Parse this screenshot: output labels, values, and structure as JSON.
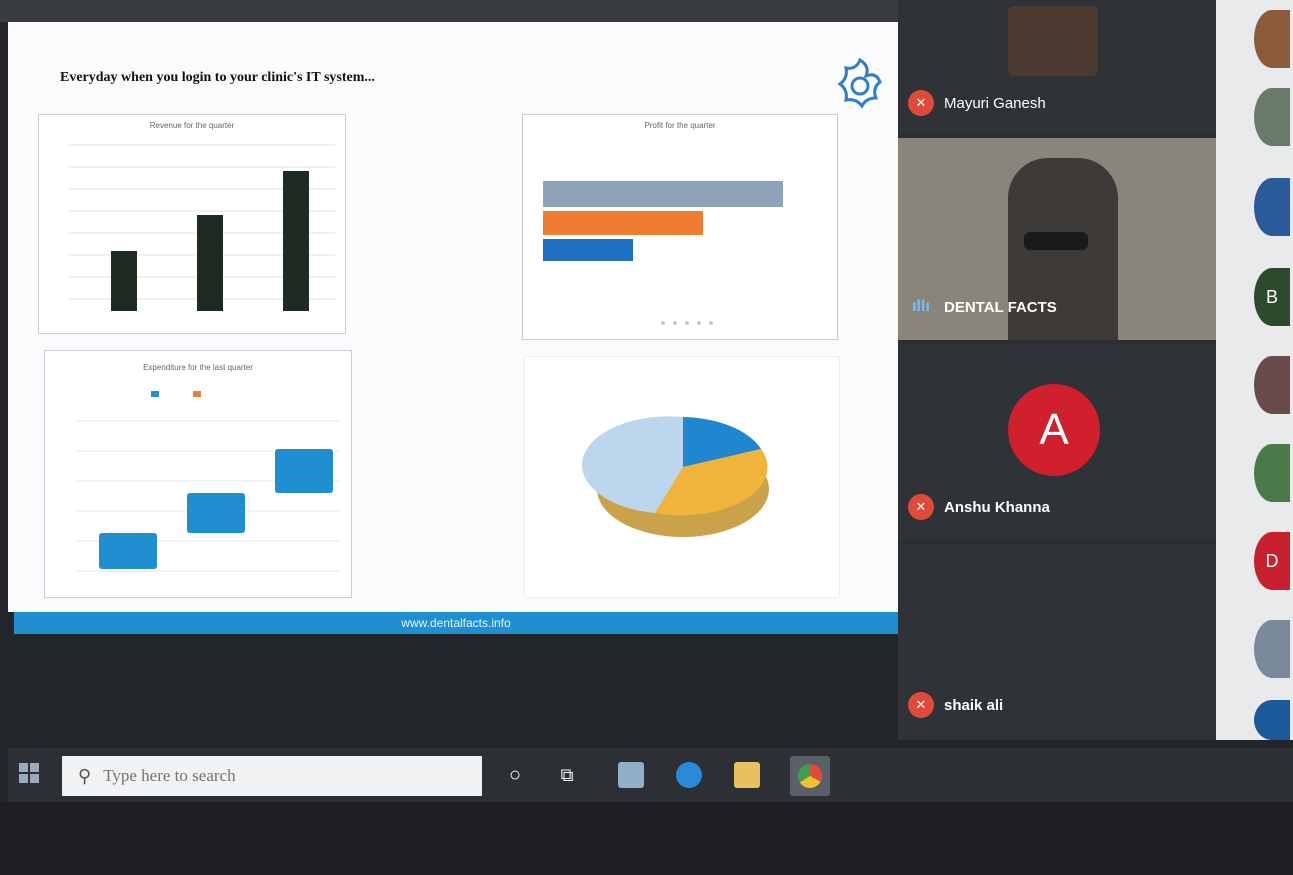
{
  "slide": {
    "title": "Everyday when you login to your clinic's IT system...",
    "footer": "www.dentalfacts.info",
    "charts": {
      "revenue": {
        "title": "Revenue for the quarter"
      },
      "profit": {
        "title": "Profit for the quarter"
      },
      "expenditure": {
        "title": "Expenditure for the last quarter"
      },
      "share": {
        "title": ""
      }
    }
  },
  "participants": [
    {
      "name": "Mayuri Ganesh",
      "muted": true
    },
    {
      "name": "DENTAL FACTS",
      "speaking": true
    },
    {
      "name": "Anshu Khanna",
      "muted": true,
      "initial": "A"
    },
    {
      "name": "shaik ali",
      "muted": true
    }
  ],
  "sidebar_avatars": [
    "B",
    "D"
  ],
  "taskbar": {
    "search_placeholder": "Type here to search",
    "apps": [
      "cortana-icon",
      "task-view-icon",
      "photos-icon",
      "edge-icon",
      "file-explorer-icon",
      "chrome-icon"
    ]
  },
  "help_label": "?",
  "colors": {
    "accent_blue": "#1f8fd2",
    "bar_dark": "#1e2a22",
    "orange": "#ed7d31",
    "gray": "#8da3b8",
    "gold": "#f0b43c",
    "mic_red": "#e04a3a",
    "avatar_red": "#d0202e"
  }
}
